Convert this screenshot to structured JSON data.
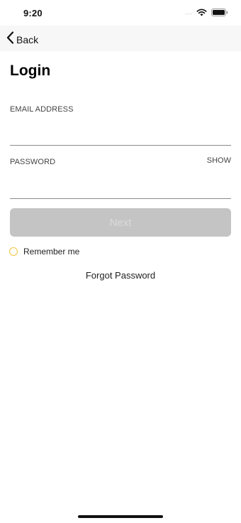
{
  "status_bar": {
    "time": "9:20",
    "signal_dots": "....",
    "icons": [
      "signal-dots-icon",
      "wifi-icon",
      "battery-icon"
    ]
  },
  "nav": {
    "back_label": "Back",
    "back_icon": "chevron-left-icon"
  },
  "page": {
    "title": "Login"
  },
  "form": {
    "email_label": "EMAIL ADDRESS",
    "email_value": "",
    "password_label": "PASSWORD",
    "password_value": "",
    "show_label": "SHOW",
    "next_label": "Next",
    "remember_label": "Remember me",
    "remember_checked": false,
    "forgot_label": "Forgot Password"
  },
  "colors": {
    "next_button_disabled_bg": "#c4c4c4",
    "next_button_disabled_text": "#dadada",
    "radio_accent": "#f2c53d",
    "nav_bg": "#f7f7f7"
  }
}
